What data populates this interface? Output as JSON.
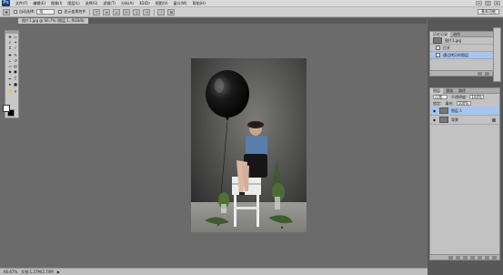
{
  "menubar": {
    "logo": "Ps",
    "items": [
      "文件(F)",
      "编辑(E)",
      "图像(I)",
      "图层(L)",
      "选择(S)",
      "滤镜(T)",
      "分析(A)",
      "3D(D)",
      "视图(V)",
      "窗口(W)",
      "帮助(H)"
    ],
    "window_controls": [
      "−",
      "□",
      "×"
    ]
  },
  "options": {
    "auto_select_label": "自动选择:",
    "auto_select_value": "组",
    "show_transform_label": "显示变换控件",
    "essentials": "基本功能"
  },
  "document": {
    "tab_title": "图片1.jpg @ 66.7% (图层 1, RGB/8)"
  },
  "status": {
    "zoom": "66.67%",
    "doc_size": "文档:1.37M/2.74M"
  },
  "history": {
    "tabs": [
      "历史记录",
      "动作"
    ],
    "snapshot": "图片1.jpg",
    "items": [
      "打开",
      "通过拷贝的图层"
    ]
  },
  "layers": {
    "tabs": [
      "图层",
      "通道",
      "路径"
    ],
    "blend_mode": "正常",
    "opacity_label": "不透明度:",
    "opacity_value": "100%",
    "lock_label": "锁定:",
    "fill_label": "填充:",
    "fill_value": "100%",
    "items": [
      {
        "name": "图层 1"
      },
      {
        "name": "背景"
      }
    ]
  },
  "colors": {
    "foreground": "#ffffff",
    "background": "#000000",
    "selection": "#a8c4ee"
  },
  "tools": [
    "move-icon",
    "marquee-icon",
    "lasso-icon",
    "magic-wand-icon",
    "crop-icon",
    "eyedropper-icon",
    "healing-brush-icon",
    "brush-icon",
    "clone-stamp-icon",
    "history-brush-icon",
    "eraser-icon",
    "gradient-icon",
    "blur-icon",
    "dodge-icon",
    "pen-icon",
    "type-icon",
    "path-select-icon",
    "shape-icon",
    "hand-icon",
    "zoom-icon"
  ]
}
